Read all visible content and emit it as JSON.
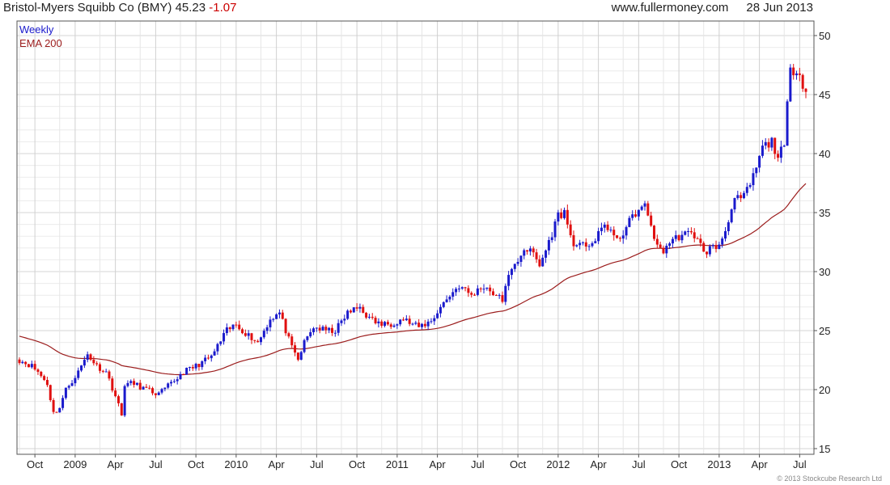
{
  "header": {
    "security": "Bristol-Myers Squibb Co (BMY)",
    "price": "45.23",
    "change": "-1.07",
    "website": "www.fullermoney.com",
    "date": "28 Jun 2013"
  },
  "copyright": "© 2013 Stockcube Research Ltd",
  "chart_data": {
    "type": "candlestick",
    "legend": [
      {
        "label": "Weekly",
        "color": "#1a1acc"
      },
      {
        "label": "EMA 200",
        "color": "#9b1c1c"
      }
    ],
    "colors": {
      "up": "#1a1acc",
      "down": "#e01010",
      "ema": "#9b1c1c",
      "grid": "#e2e2e2"
    },
    "ylim": [
      15,
      50
    ],
    "y_ticks": [
      15,
      20,
      25,
      30,
      35,
      40,
      45,
      50
    ],
    "x_ticks": [
      "Oct",
      "2009",
      "Apr",
      "Jul",
      "Oct",
      "2010",
      "Apr",
      "Jul",
      "Oct",
      "2011",
      "Apr",
      "Jul",
      "Oct",
      "2012",
      "Apr",
      "Jul",
      "Oct",
      "2013",
      "Apr",
      "Jul"
    ],
    "x_weeks": [
      5,
      18,
      31,
      44,
      57,
      70,
      83,
      96,
      109,
      122,
      135,
      148,
      161,
      174,
      187,
      200,
      213,
      226,
      239,
      252
    ],
    "close_keyframes": [
      [
        0,
        22.5
      ],
      [
        4,
        22.0
      ],
      [
        6,
        21.5
      ],
      [
        9,
        20.5
      ],
      [
        11,
        18.0
      ],
      [
        13,
        18.5
      ],
      [
        15,
        20.0
      ],
      [
        19,
        21.5
      ],
      [
        22,
        23.0
      ],
      [
        25,
        22.0
      ],
      [
        28,
        21.5
      ],
      [
        31,
        19.5
      ],
      [
        33,
        17.8
      ],
      [
        34,
        20.5
      ],
      [
        37,
        20.5
      ],
      [
        41,
        20.0
      ],
      [
        45,
        19.6
      ],
      [
        49,
        20.5
      ],
      [
        53,
        21.5
      ],
      [
        57,
        22.0
      ],
      [
        62,
        22.8
      ],
      [
        67,
        25.0
      ],
      [
        70,
        25.5
      ],
      [
        73,
        24.8
      ],
      [
        77,
        24.0
      ],
      [
        81,
        26.0
      ],
      [
        84,
        26.5
      ],
      [
        86,
        25.0
      ],
      [
        88,
        23.5
      ],
      [
        90,
        22.5
      ],
      [
        92,
        24.0
      ],
      [
        95,
        25.3
      ],
      [
        99,
        25.0
      ],
      [
        102,
        25.0
      ],
      [
        106,
        26.5
      ],
      [
        110,
        27.0
      ],
      [
        113,
        26.0
      ],
      [
        117,
        25.5
      ],
      [
        120,
        25.6
      ],
      [
        124,
        26.0
      ],
      [
        127,
        25.5
      ],
      [
        129,
        25.3
      ],
      [
        133,
        25.8
      ],
      [
        136,
        27.0
      ],
      [
        139,
        28.0
      ],
      [
        142,
        28.8
      ],
      [
        146,
        28.0
      ],
      [
        150,
        28.8
      ],
      [
        154,
        28.0
      ],
      [
        156,
        27.5
      ],
      [
        157,
        29.0
      ],
      [
        160,
        30.5
      ],
      [
        163,
        32.0
      ],
      [
        166,
        31.5
      ],
      [
        168,
        30.5
      ],
      [
        171,
        32.5
      ],
      [
        174,
        34.8
      ],
      [
        176,
        35.0
      ],
      [
        178,
        33.0
      ],
      [
        180,
        32.0
      ],
      [
        183,
        32.3
      ],
      [
        186,
        32.6
      ],
      [
        189,
        34.0
      ],
      [
        191,
        33.5
      ],
      [
        193,
        32.5
      ],
      [
        196,
        33.8
      ],
      [
        199,
        35.0
      ],
      [
        202,
        35.5
      ],
      [
        204,
        34.0
      ],
      [
        206,
        32.0
      ],
      [
        208,
        31.8
      ],
      [
        210,
        32.5
      ],
      [
        213,
        33.0
      ],
      [
        216,
        33.2
      ],
      [
        219,
        33.0
      ],
      [
        221,
        31.5
      ],
      [
        223,
        32.0
      ],
      [
        225,
        32.0
      ],
      [
        227,
        32.8
      ],
      [
        229,
        34.5
      ],
      [
        231,
        36.0
      ],
      [
        234,
        36.3
      ],
      [
        237,
        38.0
      ],
      [
        240,
        40.5
      ],
      [
        243,
        41.0
      ],
      [
        245,
        39.8
      ],
      [
        247,
        40.5
      ],
      [
        248,
        44.0
      ],
      [
        249,
        47.0
      ],
      [
        251,
        47.3
      ],
      [
        253,
        46.0
      ],
      [
        254,
        45.23
      ]
    ]
  }
}
